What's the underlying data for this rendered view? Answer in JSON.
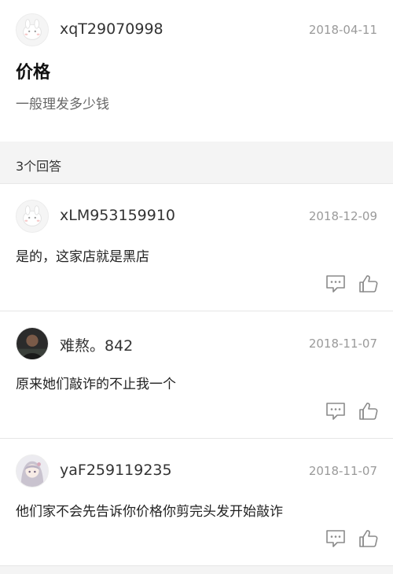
{
  "question": {
    "username": "xqT29070998",
    "date": "2018-04-11",
    "title": "价格",
    "body": "一般理发多少钱"
  },
  "answers_header": {
    "count_label": "3个回答"
  },
  "answers": [
    {
      "username": "xLM953159910",
      "date": "2018-12-09",
      "text": "是的，这家店就是黑店",
      "avatar": "default-bunny-avatar"
    },
    {
      "username": "难熬。842",
      "date": "2018-11-07",
      "text": "原来她们敲诈的不止我一个",
      "avatar": "photo-avatar"
    },
    {
      "username": "yaF259119235",
      "date": "2018-11-07",
      "text": "他们家不会先告诉你价格你剪完头发开始敲诈",
      "avatar": "anime-avatar"
    }
  ],
  "icons": {
    "comment": "comment-icon",
    "like": "thumbs-up-icon"
  },
  "colors": {
    "secondary_text": "#9a9a9a",
    "divider_bg": "#f4f4f4"
  }
}
